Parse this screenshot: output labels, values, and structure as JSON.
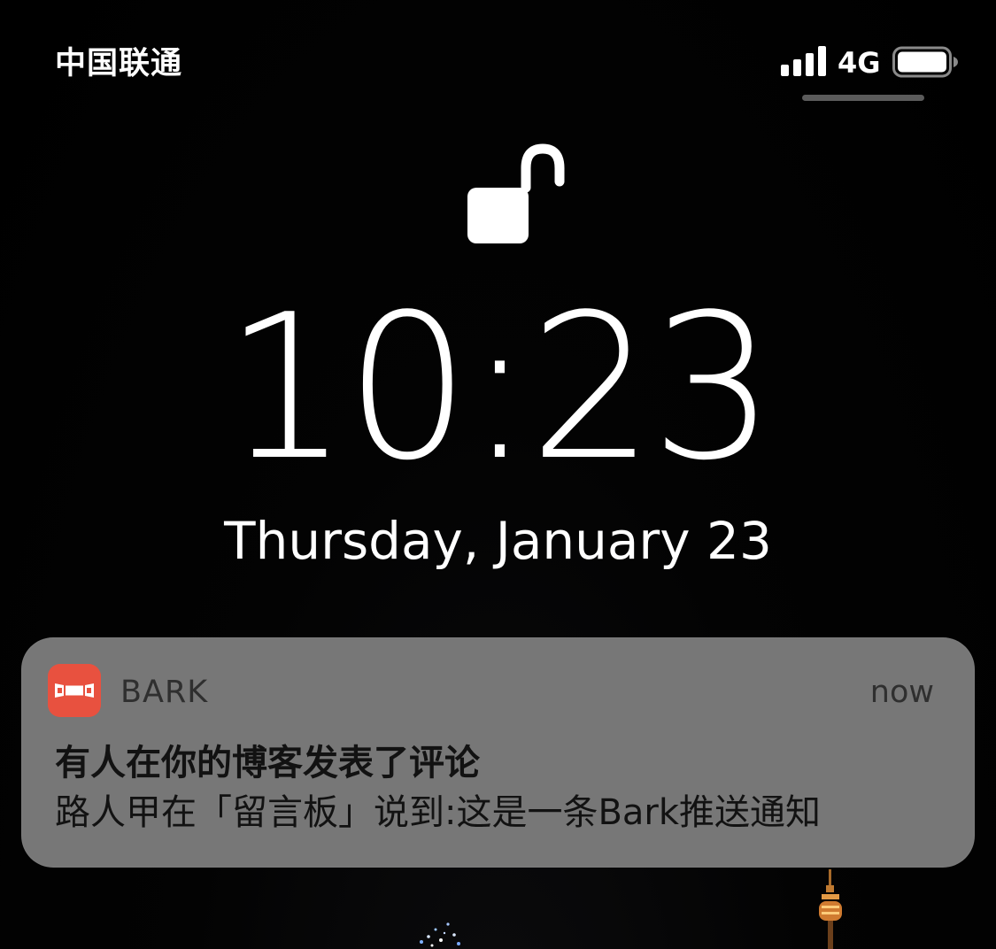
{
  "status_bar": {
    "carrier": "中国联通",
    "network": "4G",
    "signal_bars": 4,
    "battery_level": 1.0
  },
  "lock_screen": {
    "lock_icon": "unlocked-padlock-icon",
    "time": "10:23",
    "date": "Thursday, January 23"
  },
  "notification": {
    "app_icon": "bark-app-icon",
    "app_name": "BARK",
    "timestamp": "now",
    "title": "有人在你的博客发表了评论",
    "body": "路人甲在「留言板」说到:这是一条Bark推送通知",
    "icon_color": "#E8513F"
  },
  "colors": {
    "background": "#000000",
    "notification_background": "#777777",
    "text_primary": "#FFFFFF",
    "notification_text": "#121212",
    "notification_meta": "#2F2F2F"
  }
}
